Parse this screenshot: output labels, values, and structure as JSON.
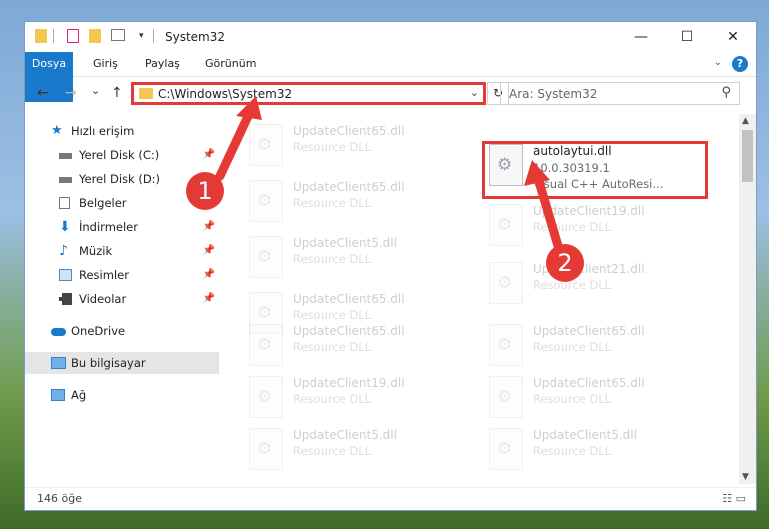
{
  "window": {
    "title": "System32",
    "minimize": "—",
    "maximize": "☐",
    "close": "✕"
  },
  "ribbon": {
    "tabs": [
      "Dosya",
      "Giriş",
      "Paylaş",
      "Görünüm"
    ],
    "help": "?"
  },
  "nav": {
    "back": "←",
    "forward": "→",
    "recent": "⌄",
    "up": "↑",
    "address": "C:\\Windows\\System32",
    "refresh": "↻",
    "search_placeholder": "Ara: System32"
  },
  "sidebar": {
    "items": [
      {
        "label": "Hızlı erişim",
        "pinned": false
      },
      {
        "label": "Yerel Disk (C:)",
        "pinned": true
      },
      {
        "label": "Yerel Disk (D:)",
        "pinned": false
      },
      {
        "label": "Belgeler",
        "pinned": true
      },
      {
        "label": "İndirmeler",
        "pinned": true
      },
      {
        "label": "Müzik",
        "pinned": true
      },
      {
        "label": "Resimler",
        "pinned": true
      },
      {
        "label": "Videolar",
        "pinned": true
      },
      {
        "label": "OneDrive",
        "pinned": false
      },
      {
        "label": "Bu bilgisayar",
        "pinned": false
      },
      {
        "label": "Ağ",
        "pinned": false
      }
    ]
  },
  "files": {
    "left": [
      {
        "name": "UpdateClient65.dll",
        "type": "Resource DLL"
      },
      {
        "name": "UpdateClient65.dll",
        "type": "Resource DLL"
      },
      {
        "name": "UpdateClient5.dll",
        "type": "Resource DLL"
      },
      {
        "name": "UpdateClient65.dll",
        "type": "Resource DLL"
      },
      {
        "name": "UpdateClient65.dll",
        "type": "Resource DLL"
      },
      {
        "name": "UpdateClient19.dll",
        "type": "Resource DLL"
      },
      {
        "name": "UpdateClient5.dll",
        "type": "Resource DLL"
      }
    ],
    "right": [
      {
        "name": "autolaytui.dll",
        "version": "10.0.30319.1",
        "type": "Visual C++ AutoResi..."
      },
      {
        "name": "UpdateClient19.dll",
        "type": "Resource DLL"
      },
      {
        "name": "UpdateClient21.dll",
        "type": "Resource DLL"
      },
      {
        "name": "UpdateClient65.dll",
        "type": "Resource DLL"
      },
      {
        "name": "UpdateClient65.dll",
        "type": "Resource DLL"
      },
      {
        "name": "UpdateClient5.dll",
        "type": "Resource DLL"
      }
    ]
  },
  "status": {
    "count": "146 öğe"
  },
  "callouts": {
    "one": "1",
    "two": "2"
  },
  "colors": {
    "accent": "#1979ca",
    "highlight": "#e53935",
    "folder": "#f3c74e"
  }
}
